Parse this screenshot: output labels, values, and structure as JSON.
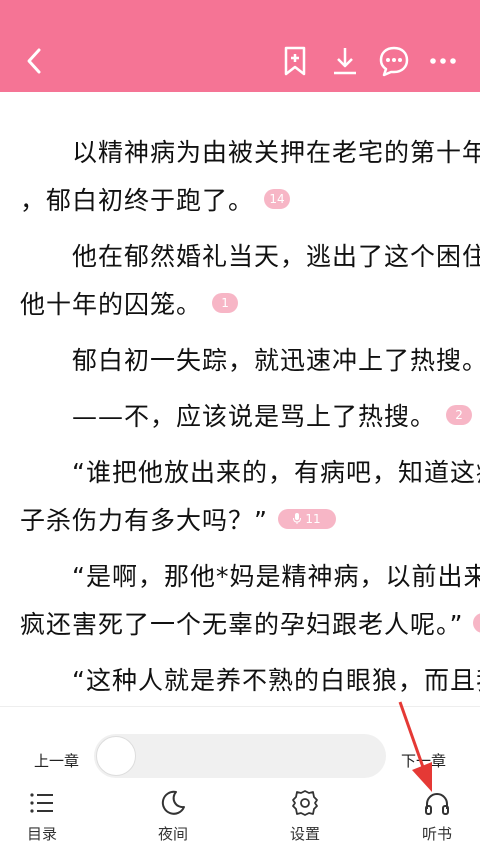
{
  "header": {
    "icons": [
      "back-icon",
      "bookmark-add-icon",
      "download-icon",
      "comment-icon",
      "more-icon"
    ],
    "background": "#f57495"
  },
  "content": {
    "lines": [
      {
        "text": "　　以精神病为由被关押在老宅的第十年"
      },
      {
        "text": "，郁白初终于跑了。",
        "badge": "14"
      },
      {
        "text": "　　他在郁然婚礼当天，逃出了这个困住"
      },
      {
        "text": "他十年的囚笼。",
        "badge": "1"
      },
      {
        "text": "　　郁白初一失踪，就迅速冲上了热搜。",
        "badge": "1"
      },
      {
        "text": "　　——不，应该说是骂上了热搜。",
        "badge": "2"
      },
      {
        "text": "　　“谁把他放出来的，有病吧，知道这疯"
      },
      {
        "text": "子杀伤力有多大吗？”",
        "voice_badge": "11"
      },
      {
        "text": "　　“是啊，那他*妈是精神病，以前出来"
      },
      {
        "text": "疯还害死了一个无辜的孕妇跟老人呢。”",
        "voice_badge": "9"
      },
      {
        "text": "　　“这种人就是养不熟的白眼狼，而且我"
      }
    ]
  },
  "bottom": {
    "prev_chapter": "上一章",
    "next_chapter": "下一章",
    "progress": 0,
    "nav": [
      {
        "label": "目录",
        "icon": "menu-list-icon"
      },
      {
        "label": "夜间",
        "icon": "moon-icon"
      },
      {
        "label": "设置",
        "icon": "gear-icon"
      },
      {
        "label": "听书",
        "icon": "headphones-icon"
      }
    ]
  },
  "colors": {
    "accent": "#f57495",
    "badge": "#f7b6c6",
    "arrow": "#e53935"
  }
}
